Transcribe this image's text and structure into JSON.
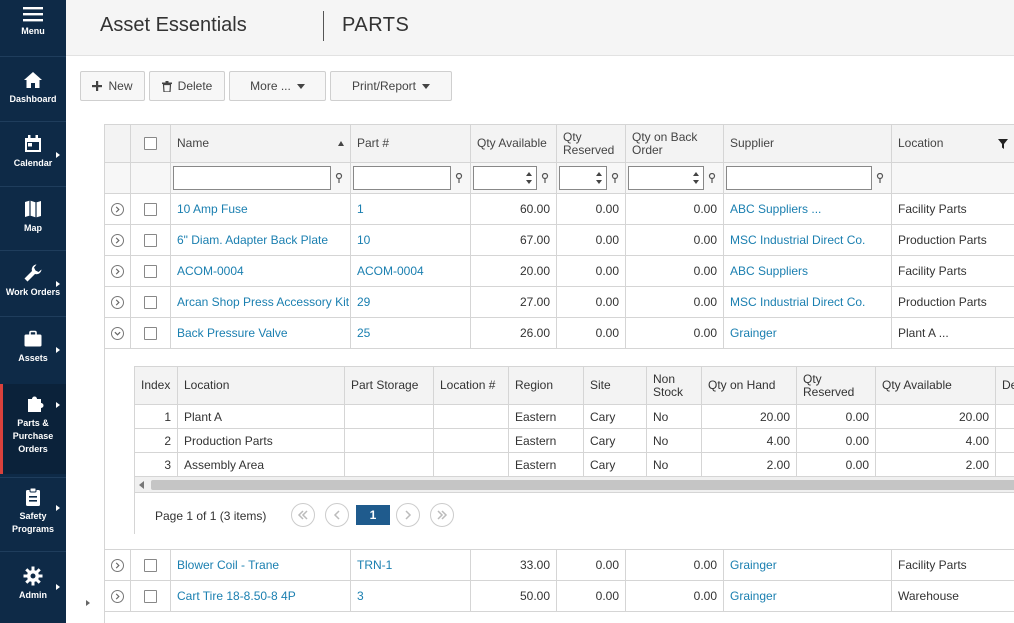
{
  "sidebar": {
    "menu": "Menu",
    "items": [
      {
        "label": "Dashboard"
      },
      {
        "label": "Calendar"
      },
      {
        "label": "Map"
      },
      {
        "label": "Work Orders"
      },
      {
        "label": "Assets"
      },
      {
        "label": "Parts & Purchase Orders"
      },
      {
        "label": "Safety Programs"
      },
      {
        "label": "Admin"
      }
    ]
  },
  "header": {
    "app_title": "Asset Essentials",
    "page_title": "PARTS"
  },
  "toolbar": {
    "new": "New",
    "delete": "Delete",
    "more": "More ...",
    "print": "Print/Report"
  },
  "grid": {
    "columns": [
      "Name",
      "Part #",
      "Qty Available",
      "Qty Reserved",
      "Qty on Back Order",
      "Supplier",
      "Location"
    ],
    "rows": [
      {
        "name": "10 Amp Fuse",
        "part": "1",
        "qty_available": "60.00",
        "qty_reserved": "0.00",
        "qty_back": "0.00",
        "supplier": "ABC Suppliers ...",
        "location": "Facility Parts"
      },
      {
        "name": "6\" Diam. Adapter Back Plate",
        "part": "10",
        "qty_available": "67.00",
        "qty_reserved": "0.00",
        "qty_back": "0.00",
        "supplier": "MSC Industrial Direct Co.",
        "location": "Production Parts"
      },
      {
        "name": "ACOM-0004",
        "part": "ACOM-0004",
        "qty_available": "20.00",
        "qty_reserved": "0.00",
        "qty_back": "0.00",
        "supplier": "ABC Suppliers",
        "location": "Facility Parts"
      },
      {
        "name": "Arcan Shop Press Accessory Kit",
        "part": "29",
        "qty_available": "27.00",
        "qty_reserved": "0.00",
        "qty_back": "0.00",
        "supplier": "MSC Industrial Direct Co.",
        "location": "Production Parts"
      },
      {
        "name": "Back Pressure Valve",
        "part": "25",
        "qty_available": "26.00",
        "qty_reserved": "0.00",
        "qty_back": "0.00",
        "supplier": "Grainger",
        "location": "Plant A ..."
      },
      {
        "name": "Blower Coil - Trane",
        "part": "TRN-1",
        "qty_available": "33.00",
        "qty_reserved": "0.00",
        "qty_back": "0.00",
        "supplier": "Grainger",
        "location": "Facility Parts"
      },
      {
        "name": "Cart Tire 18-8.50-8 4P",
        "part": "3",
        "qty_available": "50.00",
        "qty_reserved": "0.00",
        "qty_back": "0.00",
        "supplier": "Grainger",
        "location": "Warehouse"
      }
    ]
  },
  "detail": {
    "columns": [
      "Index",
      "Location",
      "Part Storage",
      "Location #",
      "Region",
      "Site",
      "Non Stock",
      "Qty on Hand",
      "Qty Reserved",
      "Qty Available",
      "De"
    ],
    "rows": [
      {
        "index": "1",
        "location": "Plant A",
        "part_storage": "",
        "location_num": "",
        "region": "Eastern",
        "site": "Cary",
        "non_stock": "No",
        "qty_on_hand": "20.00",
        "qty_reserved": "0.00",
        "qty_available": "20.00"
      },
      {
        "index": "2",
        "location": "Production Parts",
        "part_storage": "",
        "location_num": "",
        "region": "Eastern",
        "site": "Cary",
        "non_stock": "No",
        "qty_on_hand": "4.00",
        "qty_reserved": "0.00",
        "qty_available": "4.00"
      },
      {
        "index": "3",
        "location": "Assembly Area",
        "part_storage": "",
        "location_num": "",
        "region": "Eastern",
        "site": "Cary",
        "non_stock": "No",
        "qty_on_hand": "2.00",
        "qty_reserved": "0.00",
        "qty_available": "2.00"
      }
    ],
    "pager_info": "Page 1 of 1 (3 items)",
    "current_page": "1"
  },
  "colors": {
    "sidebar_bg": "#0e2a47",
    "link": "#1a7fb0",
    "active_marker": "#d9413c",
    "pager_active": "#1f5b8d"
  }
}
